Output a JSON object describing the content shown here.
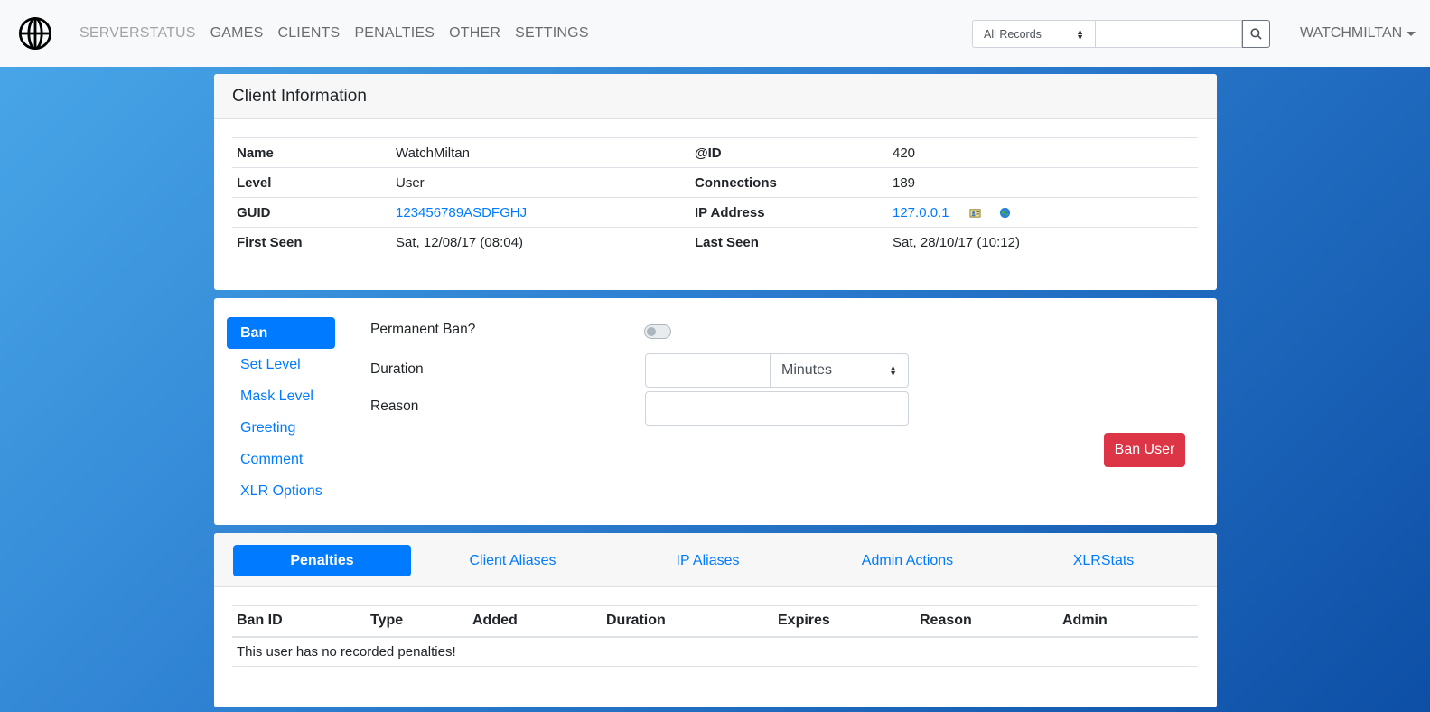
{
  "navbar": {
    "links": [
      "SERVERSTATUS",
      "GAMES",
      "CLIENTS",
      "PENALTIES",
      "OTHER",
      "SETTINGS"
    ],
    "search_scope": "All Records",
    "search_value": "",
    "user": "WATCHMILTAN"
  },
  "client_info": {
    "title": "Client Information",
    "rows": [
      {
        "l1": "Name",
        "v1": "WatchMiltan",
        "l2": "@ID",
        "v2": "420"
      },
      {
        "l1": "Level",
        "v1": "User",
        "l2": "Connections",
        "v2": "189"
      },
      {
        "l1": "GUID",
        "v1": "123456789ASDFGHJ",
        "l2": "IP Address",
        "v2": "127.0.0.1"
      },
      {
        "l1": "First Seen",
        "v1": "Sat, 12/08/17 (08:04)",
        "l2": "Last Seen",
        "v2": "Sat, 28/10/17 (10:12)"
      }
    ]
  },
  "actions": {
    "menu": [
      "Ban",
      "Set Level",
      "Mask Level",
      "Greeting",
      "Comment",
      "XLR Options"
    ],
    "active": "Ban",
    "permanent_label": "Permanent Ban?",
    "duration_label": "Duration",
    "duration_value": "",
    "duration_unit": "Minutes",
    "reason_label": "Reason",
    "reason_value": "",
    "submit_label": "Ban User"
  },
  "tabs": {
    "items": [
      "Penalties",
      "Client Aliases",
      "IP Aliases",
      "Admin Actions",
      "XLRStats"
    ],
    "active": "Penalties",
    "columns": [
      "Ban ID",
      "Type",
      "Added",
      "Duration",
      "Expires",
      "Reason",
      "Admin"
    ],
    "empty_message": "This user has no recorded penalties!"
  },
  "colors": {
    "primary": "#007bff",
    "danger": "#dc3545"
  }
}
